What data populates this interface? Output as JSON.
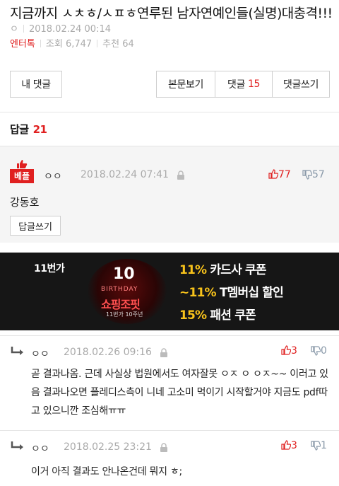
{
  "post": {
    "title": "지금까지 ㅅㅊㅎ/ㅅㅍㅎ연루된 남자연예인들(실명)대충격!!!",
    "author": "ㅇ",
    "date": "2018.02.24 00:14",
    "category": "엔터톡",
    "views_label": "조회 6,747",
    "likes_label": "추천 64"
  },
  "actions": {
    "my_comments": "내 댓글",
    "view_body": "본문보기",
    "comments_label": "댓글",
    "comments_count": "15",
    "write_comment": "댓글쓰기"
  },
  "replies": {
    "label": "답글",
    "count": "21"
  },
  "best_comment": {
    "badge": "베플",
    "nick": "ㅇㅇ",
    "date": "2018.02.24 07:41",
    "up": "77",
    "down": "57",
    "body": "강동호",
    "reply_button": "답글쓰기"
  },
  "banner": {
    "logo": "11번가",
    "badge_number": "10",
    "badge_birthday": "BIRTHDAY",
    "badge_show": "쇼핑조핏",
    "badge_sub": "11번가 10주년",
    "line1_pct": "11%",
    "line1_text": " 카드사 쿠폰",
    "line2_pct": "~11%",
    "line2_text": " T멤버십 할인",
    "line3_pct": "15%",
    "line3_text": " 패션 쿠폰"
  },
  "comments": [
    {
      "nick": "ㅇㅇ",
      "date": "2018.02.26 09:16",
      "up": "3",
      "down": "0",
      "body": "곧 결과나옴. 근데 사실상 법원에서도 여자잘못 ㅇㅈ ㅇ ㅇㅈ~~ 이러고 있음 결과나오면 플레디스측이 니네 고소미 먹이기 시작할거야 지금도 pdf따고 있으니깐 조심해ㅠㅠ"
    },
    {
      "nick": "ㅇㅇ",
      "date": "2018.02.25 23:21",
      "up": "3",
      "down": "1",
      "body": "이거 아직 결과도 안나온건데 뭐지 ㅎ;"
    }
  ],
  "colors": {
    "accent": "#e02020",
    "muted": "#aaaaaa",
    "down_vote": "#8898a8",
    "banner_yellow": "#f7c21b"
  }
}
